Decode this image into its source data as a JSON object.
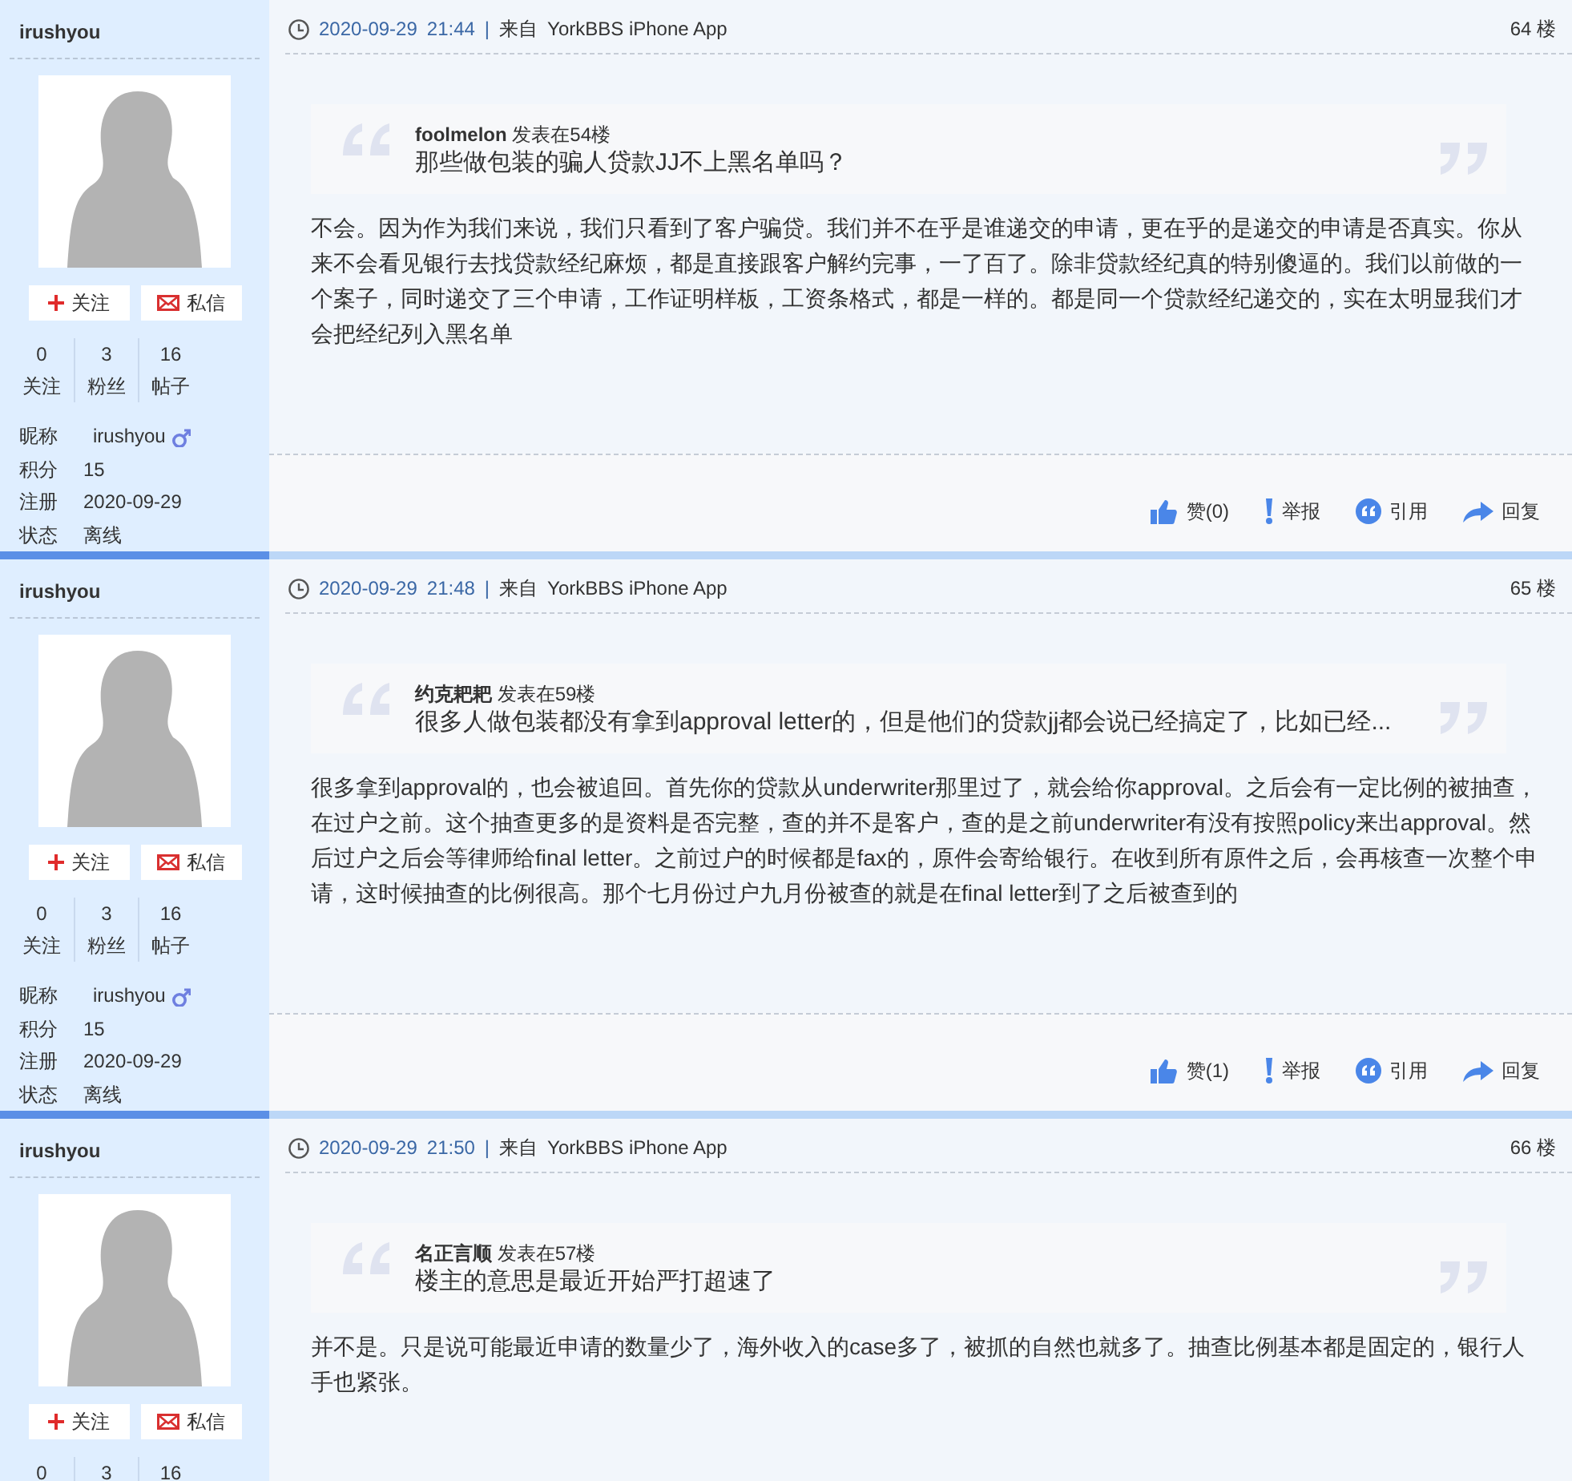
{
  "posts": [
    {
      "user": {
        "name": "irushyou",
        "buttons": [
          {
            "kind": "follow",
            "label": "关注"
          },
          {
            "kind": "message",
            "label": "私信"
          }
        ],
        "stats": [
          {
            "value": "0",
            "label": "关注"
          },
          {
            "value": "3",
            "label": "粉丝"
          },
          {
            "value": "16",
            "label": "帖子"
          }
        ],
        "info": [
          {
            "kind": "nickname",
            "label": "昵称",
            "value": "irushyou",
            "male_symbol": true
          },
          {
            "kind": "plain",
            "label": "积分",
            "value": "15"
          },
          {
            "kind": "plain",
            "label": "注册",
            "value": "2020-09-29"
          },
          {
            "kind": "plain",
            "label": "状态",
            "value": "离线"
          }
        ]
      },
      "date": "2020-09-29",
      "time": "21:44",
      "separator": "|",
      "source_prefix": "来自",
      "source": "YorkBBS iPhone App",
      "floor": "64 楼",
      "quote": {
        "author": "foolmelon",
        "posted": "发表在54楼",
        "text": "那些做包装的骗人贷款JJ不上黑名单吗？"
      },
      "body": "不会。因为作为我们来说，我们只看到了客户骗贷。我们并不在乎是谁递交的申请，更在乎的是递交的申请是否真实。你从来不会看见银行去找贷款经纪麻烦，都是直接跟客户解约完事，一了百了。除非贷款经纪真的特别傻逼的。我们以前做的一个案子，同时递交了三个申请，工作证明样板，工资条格式，都是一样的。都是同一个贷款经纪递交的，实在太明显我们才会把经纪列入黑名单",
      "actions": [
        {
          "kind": "like",
          "label": "赞(0)"
        },
        {
          "kind": "report",
          "label": "举报"
        },
        {
          "kind": "quote",
          "label": "引用"
        },
        {
          "kind": "reply",
          "label": "回复"
        }
      ]
    },
    {
      "user": {
        "name": "irushyou",
        "buttons": [
          {
            "kind": "follow",
            "label": "关注"
          },
          {
            "kind": "message",
            "label": "私信"
          }
        ],
        "stats": [
          {
            "value": "0",
            "label": "关注"
          },
          {
            "value": "3",
            "label": "粉丝"
          },
          {
            "value": "16",
            "label": "帖子"
          }
        ],
        "info": [
          {
            "kind": "nickname",
            "label": "昵称",
            "value": "irushyou",
            "male_symbol": true
          },
          {
            "kind": "plain",
            "label": "积分",
            "value": "15"
          },
          {
            "kind": "plain",
            "label": "注册",
            "value": "2020-09-29"
          },
          {
            "kind": "plain",
            "label": "状态",
            "value": "离线"
          }
        ]
      },
      "date": "2020-09-29",
      "time": "21:48",
      "separator": "|",
      "source_prefix": "来自",
      "source": "YorkBBS iPhone App",
      "floor": "65 楼",
      "quote": {
        "author": "约克耙耙",
        "posted": "发表在59楼",
        "text": "很多人做包装都没有拿到approval letter的，但是他们的贷款jj都会说已经搞定了，比如已经..."
      },
      "body": "很多拿到approval的，也会被追回。首先你的贷款从underwriter那里过了，就会给你approval。之后会有一定比例的被抽查，在过户之前。这个抽查更多的是资料是否完整，查的并不是客户，查的是之前underwriter有没有按照policy来出approval。然后过户之后会等律师给final letter。之前过户的时候都是fax的，原件会寄给银行。在收到所有原件之后，会再核查一次整个申请，这时候抽查的比例很高。那个七月份过户九月份被查的就是在final letter到了之后被查到的",
      "actions": [
        {
          "kind": "like",
          "label": "赞(1)"
        },
        {
          "kind": "report",
          "label": "举报"
        },
        {
          "kind": "quote",
          "label": "引用"
        },
        {
          "kind": "reply",
          "label": "回复"
        }
      ]
    },
    {
      "user": {
        "name": "irushyou",
        "buttons": [
          {
            "kind": "follow",
            "label": "关注"
          },
          {
            "kind": "message",
            "label": "私信"
          }
        ],
        "stats": [
          {
            "value": "0"
          },
          {
            "value": "3"
          },
          {
            "value": "16"
          }
        ]
      },
      "date": "2020-09-29",
      "time": "21:50",
      "separator": "|",
      "source_prefix": "来自",
      "source": "YorkBBS iPhone App",
      "floor": "66 楼",
      "quote": {
        "author": "名正言顺",
        "posted": "发表在57楼",
        "text": "楼主的意思是最近开始严打超速了"
      },
      "body": "并不是。只是说可能最近申请的数量少了，海外收入的case多了，被抓的自然也就多了。抽查比例基本都是固定的，银行人手也紧张。"
    }
  ]
}
